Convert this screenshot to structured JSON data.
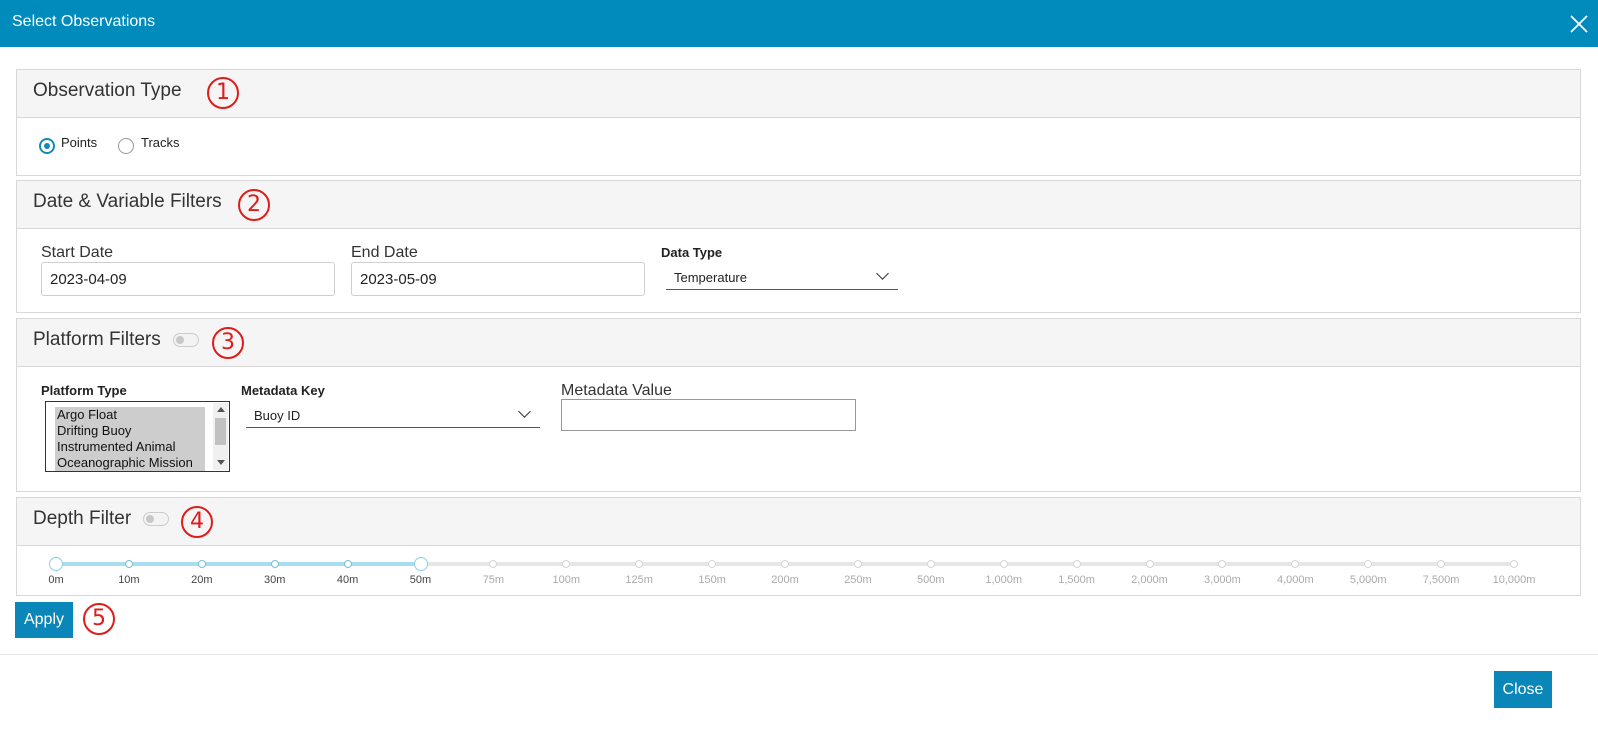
{
  "dialog": {
    "title": "Select Observations"
  },
  "observation_type": {
    "title": "Observation Type",
    "marker": "1",
    "options": [
      {
        "label": "Points",
        "selected": true
      },
      {
        "label": "Tracks",
        "selected": false
      }
    ]
  },
  "date_filters": {
    "title": "Date & Variable Filters",
    "marker": "2",
    "start_label": "Start Date",
    "start_value": "2023-04-09",
    "end_label": "End Date",
    "end_value": "2023-05-09",
    "data_type_label": "Data Type",
    "data_type_value": "Temperature"
  },
  "platform_filters": {
    "title": "Platform Filters",
    "marker": "3",
    "enabled": false,
    "platform_type_label": "Platform Type",
    "platform_types": [
      "Argo Float",
      "Drifting Buoy",
      "Instrumented Animal",
      "Oceanographic Mission"
    ],
    "metadata_key_label": "Metadata Key",
    "metadata_key_value": "Buoy ID",
    "metadata_value_label": "Metadata Value",
    "metadata_value": ""
  },
  "depth_filter": {
    "title": "Depth Filter",
    "marker": "4",
    "enabled": false,
    "ticks": [
      "0m",
      "10m",
      "20m",
      "30m",
      "40m",
      "50m",
      "75m",
      "100m",
      "125m",
      "150m",
      "200m",
      "250m",
      "500m",
      "1,000m",
      "1,500m",
      "2,000m",
      "3,000m",
      "4,000m",
      "5,000m",
      "7,500m",
      "10,000m"
    ],
    "range": [
      "0m",
      "50m"
    ]
  },
  "apply": {
    "label": "Apply",
    "marker": "5"
  },
  "close": {
    "label": "Close"
  },
  "colors": {
    "header": "#008bbd",
    "accent": "#0a86b8",
    "marker": "#e01b1b"
  }
}
